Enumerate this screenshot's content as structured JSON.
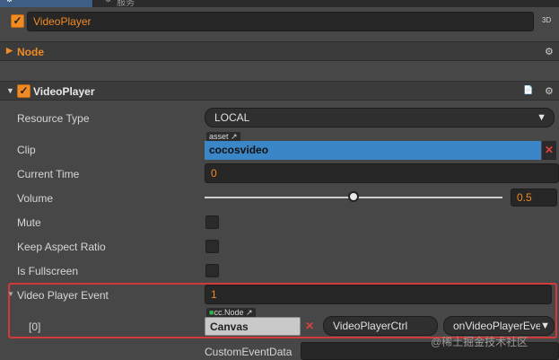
{
  "tabs": {
    "inspector_glyph": "⚙",
    "services_glyph": "⚙",
    "services_label": "服务"
  },
  "node_header": {
    "name": "VideoPlayer",
    "badge_3d": "3D"
  },
  "node_section": {
    "title": "Node",
    "expand_glyph": "▶"
  },
  "component": {
    "title": "VideoPlayer",
    "collapse_glyph": "▼",
    "book_icon": "📄",
    "gear_icon": "⚙"
  },
  "properties": {
    "resource_type": {
      "label": "Resource Type",
      "value": "LOCAL",
      "caret": "▼"
    },
    "clip": {
      "label": "Clip",
      "tag": "asset",
      "value": "cocosvideo",
      "clear": "✕"
    },
    "current_time": {
      "label": "Current Time",
      "value": "0"
    },
    "volume": {
      "label": "Volume",
      "value": "0.5",
      "slider_fraction": 0.5
    },
    "mute": {
      "label": "Mute"
    },
    "keep_aspect_ratio": {
      "label": "Keep Aspect Ratio"
    },
    "is_fullscreen": {
      "label": "Is Fullscreen"
    },
    "video_player_event": {
      "label": "Video Player Event",
      "value": "1",
      "collapse_glyph": "▼"
    },
    "event_0": {
      "label": "[0]",
      "tag": "cc.Node",
      "node": "Canvas",
      "clear": "✕",
      "component": "VideoPlayerCtrl",
      "handler": "onVideoPlayerEver",
      "caret": "▼"
    },
    "custom_event_data": {
      "label": "CustomEventData"
    }
  },
  "watermark": "@稀土掘金技术社区",
  "colors": {
    "accent": "#f08a24",
    "highlight": "#d23a3a",
    "asset": "#3a86c6"
  }
}
